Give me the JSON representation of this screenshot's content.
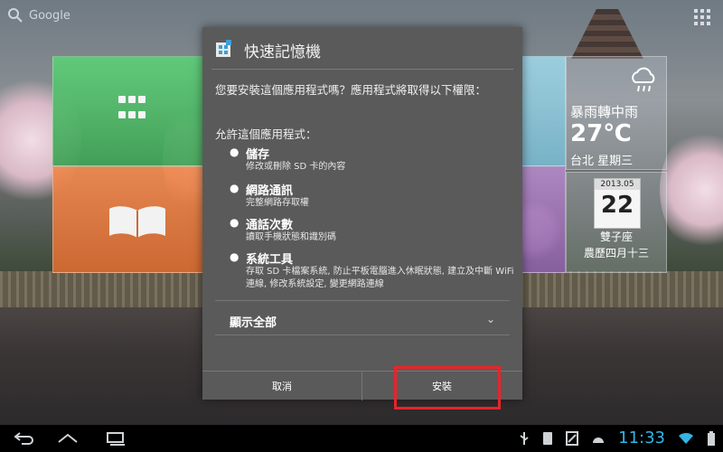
{
  "search": {
    "label": "Google"
  },
  "weather": {
    "condition": "暴雨轉中雨",
    "temp": "27℃",
    "city": "台北 星期三"
  },
  "calendar": {
    "month": "2013.05",
    "day": "22",
    "sign": "雙子座",
    "lunar": "農歷四月十三"
  },
  "dialog": {
    "title": "快速記憶機",
    "question": "您要安裝這個應用程式嗎？應用程式將取得以下權限：",
    "allow": "允許這個應用程式：",
    "permissions": [
      {
        "title": "儲存",
        "desc": "修改或刪除 SD 卡的內容"
      },
      {
        "title": "網路通訊",
        "desc": "完整網路存取權"
      },
      {
        "title": "通話次數",
        "desc": "讀取手機狀態和識別碼"
      },
      {
        "title": "系統工具",
        "desc": "存取 SD 卡檔案系統, 防止平板電腦進入休眠狀態, 建立及中斷 WiFi 連線, 修改系統設定, 變更網路連線"
      }
    ],
    "show_all": "顯示全部",
    "cancel": "取消",
    "install": "安裝"
  },
  "status": {
    "time": "11:33"
  },
  "colors": {
    "highlight": "#e8242b",
    "clock": "#33b5e5",
    "dialog_bg": "#5a5a5a"
  }
}
